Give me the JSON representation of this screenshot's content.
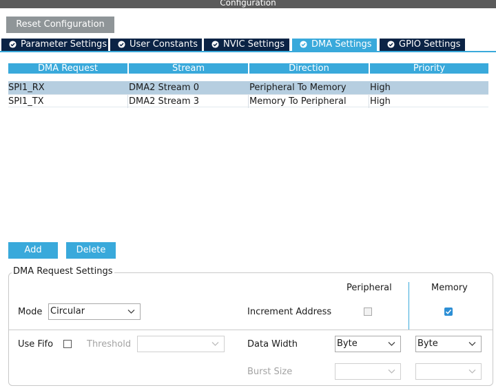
{
  "window": {
    "title": "Configuration"
  },
  "toolbar": {
    "reset_label": "Reset Configuration"
  },
  "tabs": [
    {
      "label": "Parameter Settings",
      "active": false
    },
    {
      "label": "User Constants",
      "active": false
    },
    {
      "label": "NVIC Settings",
      "active": false
    },
    {
      "label": "DMA Settings",
      "active": true
    },
    {
      "label": "GPIO Settings",
      "active": false
    }
  ],
  "table": {
    "columns": [
      "DMA Request",
      "Stream",
      "Direction",
      "Priority"
    ],
    "rows": [
      {
        "request": "SPI1_RX",
        "stream": "DMA2 Stream 0",
        "direction": "Peripheral To Memory",
        "priority": "High",
        "selected": true
      },
      {
        "request": "SPI1_TX",
        "stream": "DMA2 Stream 3",
        "direction": "Memory To Peripheral",
        "priority": "High",
        "selected": false
      }
    ]
  },
  "actions": {
    "add_label": "Add",
    "delete_label": "Delete"
  },
  "settings": {
    "title": "DMA Request Settings",
    "peripheral_header": "Peripheral",
    "memory_header": "Memory",
    "mode_label": "Mode",
    "mode_value": "Circular",
    "increment_label": "Increment Address",
    "peripheral_increment": false,
    "memory_increment": true,
    "use_fifo_label": "Use Fifo",
    "use_fifo": false,
    "threshold_label": "Threshold",
    "threshold_value": "",
    "data_width_label": "Data Width",
    "peripheral_data_width": "Byte",
    "memory_data_width": "Byte",
    "burst_size_label": "Burst Size",
    "peripheral_burst": "",
    "memory_burst": ""
  },
  "colors": {
    "accent": "#39a9db",
    "tab_dark": "#0b2345",
    "selected_row": "#b6cee0",
    "reset_button": "#8f9598"
  }
}
